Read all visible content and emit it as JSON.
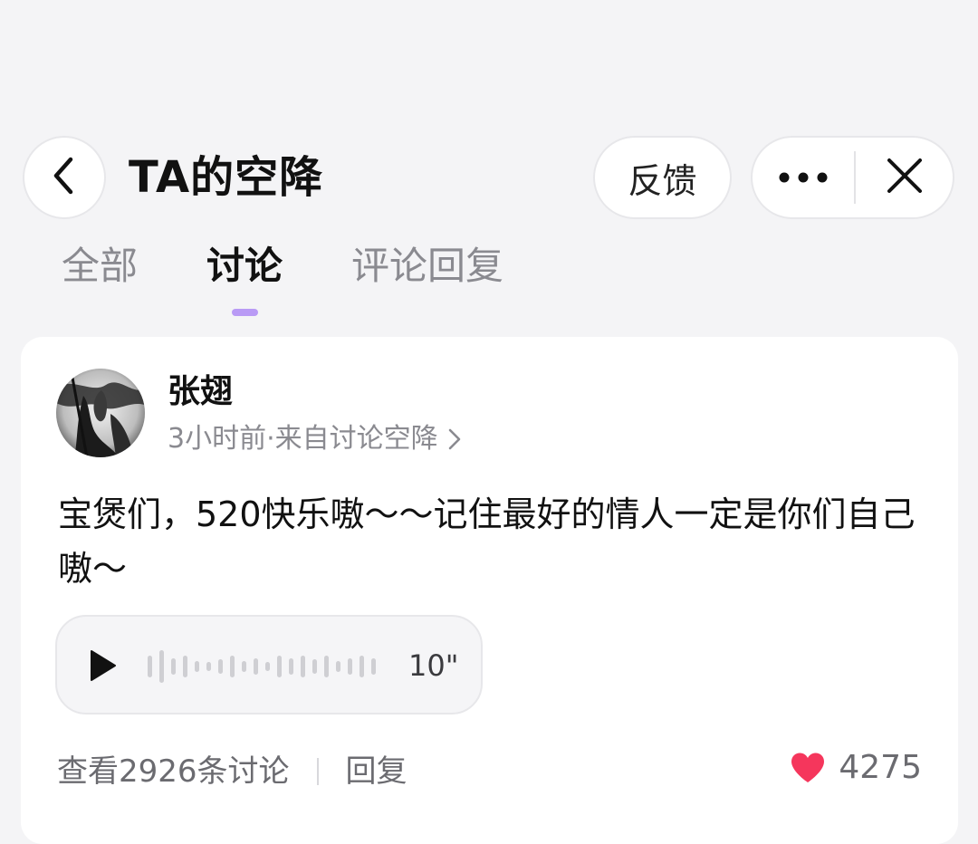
{
  "header": {
    "title": "TA的空降",
    "feedback_label": "反馈"
  },
  "tabs": [
    {
      "label": "全部",
      "active": false
    },
    {
      "label": "讨论",
      "active": true
    },
    {
      "label": "评论回复",
      "active": false
    }
  ],
  "post": {
    "username": "张翅",
    "meta": "3小时前·来自讨论空降",
    "content": "宝煲们，520快乐嗷～～记住最好的情人一定是你们自己嗷～",
    "audio": {
      "duration": "10\""
    },
    "view_discussions": "查看2926条讨论",
    "reply_label": "回复",
    "like_count": "4275"
  },
  "colors": {
    "background": "#f4f4f6",
    "card": "#ffffff",
    "tab_indicator": "#b99af5",
    "heart": "#f5365c",
    "secondary_text": "#8a8a90"
  },
  "icons": {
    "back": "chevron-left-icon",
    "more": "more-dots-icon",
    "close": "close-icon",
    "meta_arrow": "chevron-right-icon",
    "play": "play-icon",
    "like": "heart-icon"
  }
}
